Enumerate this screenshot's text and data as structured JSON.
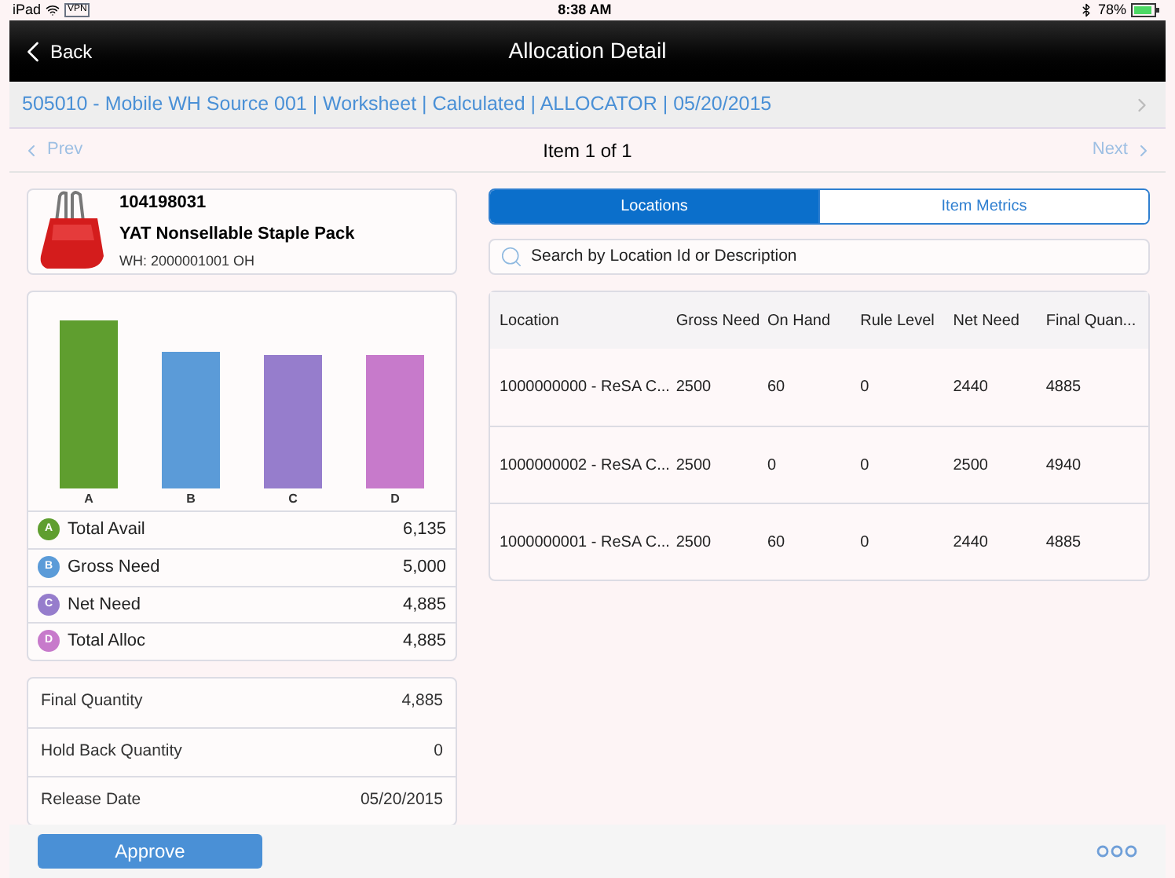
{
  "status_bar": {
    "device": "iPad",
    "network": "VPN",
    "time": "8:38 AM",
    "battery": "78%"
  },
  "nav": {
    "back": "Back",
    "title": "Allocation Detail"
  },
  "breadcrumb": "505010 - Mobile WH Source 001 | Worksheet | Calculated | ALLOCATOR | 05/20/2015",
  "pager": {
    "prev": "Prev",
    "position": "Item 1 of 1",
    "next": "Next",
    "prev_disabled": true,
    "next_disabled": true
  },
  "item": {
    "number": "104198031",
    "name": "YAT Nonsellable Staple Pack",
    "warehouse": "WH: 2000001001 OH"
  },
  "bars": [
    {
      "label": "A"
    },
    {
      "label": "B"
    },
    {
      "label": "C"
    },
    {
      "label": "D"
    }
  ],
  "legend": [
    {
      "letter": "A",
      "label": "Total Avail",
      "value": "6,135",
      "color": "#5f9e2f"
    },
    {
      "letter": "B",
      "label": "Gross Need",
      "value": "5,000",
      "color": "#5b9bd8"
    },
    {
      "letter": "C",
      "label": "Net Need",
      "value": "4,885",
      "color": "#967dcc"
    },
    {
      "letter": "D",
      "label": "Total Alloc",
      "value": "4,885",
      "color": "#c77acb"
    }
  ],
  "details": [
    {
      "label": "Final Quantity",
      "value": "4,885"
    },
    {
      "label": "Hold Back Quantity",
      "value": "0"
    },
    {
      "label": "Release Date",
      "value": "05/20/2015"
    }
  ],
  "tabs": [
    {
      "label": "Locations",
      "selected": true
    },
    {
      "label": "Item Metrics",
      "selected": false
    }
  ],
  "search": {
    "placeholder": "Search by Location Id or Description"
  },
  "table": {
    "columns": [
      "Location",
      "Gross Need",
      "On Hand",
      "Rule Level",
      "Net Need",
      "Final Quan..."
    ],
    "rows": [
      [
        "1000000000 - ReSA C...",
        "2500",
        "60",
        "0",
        "2440",
        "4885"
      ],
      [
        "1000000002 - ReSA C...",
        "2500",
        "0",
        "0",
        "2500",
        "4940"
      ],
      [
        "1000000001 - ReSA C...",
        "2500",
        "60",
        "0",
        "2440",
        "4885"
      ]
    ]
  },
  "footer": {
    "approve": "Approve"
  }
}
